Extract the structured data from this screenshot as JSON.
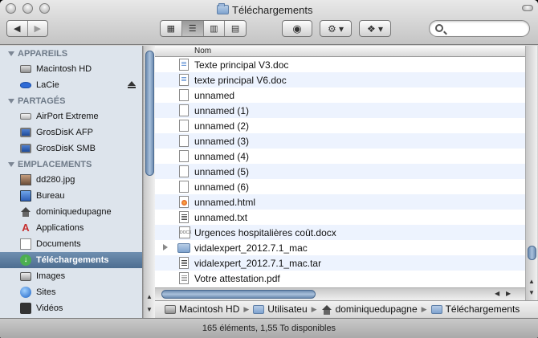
{
  "window": {
    "title": "Téléchargements",
    "toolbar": {
      "back_icon": "back-arrow-icon",
      "forward_icon": "forward-arrow-icon",
      "views": [
        "icon-view",
        "list-view",
        "column-view",
        "coverflow-view"
      ],
      "active_view": "list-view",
      "quicklook_icon": "eye-icon",
      "action_icon": "gear-icon",
      "dropbox_icon": "dropbox-icon",
      "search_placeholder": ""
    }
  },
  "sidebar": {
    "sections": [
      {
        "label": "APPAREILS",
        "items": [
          {
            "label": "Macintosh HD",
            "icon": "hard-drive-icon"
          },
          {
            "label": "LaCie",
            "icon": "external-drive-icon",
            "eject": true
          }
        ]
      },
      {
        "label": "PARTAGÉS",
        "items": [
          {
            "label": "AirPort Extreme",
            "icon": "airport-icon"
          },
          {
            "label": "GrosDisK AFP",
            "icon": "network-screen-icon"
          },
          {
            "label": "GrosDisK SMB",
            "icon": "network-screen-icon"
          }
        ]
      },
      {
        "label": "EMPLACEMENTS",
        "items": [
          {
            "label": "dd280.jpg",
            "icon": "photo-icon"
          },
          {
            "label": "Bureau",
            "icon": "desktop-icon"
          },
          {
            "label": "dominiquedupagne",
            "icon": "home-icon"
          },
          {
            "label": "Applications",
            "icon": "applications-icon"
          },
          {
            "label": "Documents",
            "icon": "documents-icon"
          },
          {
            "label": "Téléchargements",
            "icon": "downloads-icon",
            "selected": true
          },
          {
            "label": "Images",
            "icon": "camera-icon"
          },
          {
            "label": "Sites",
            "icon": "globe-icon"
          },
          {
            "label": "Vidéos",
            "icon": "video-icon"
          }
        ]
      }
    ]
  },
  "list": {
    "column_header": "Nom",
    "rows": [
      {
        "name": "Texte principal V3.doc",
        "type": "doc"
      },
      {
        "name": "texte principal V6.doc",
        "type": "doc"
      },
      {
        "name": "unnamed",
        "type": "blank"
      },
      {
        "name": "unnamed (1)",
        "type": "blank"
      },
      {
        "name": "unnamed (2)",
        "type": "blank"
      },
      {
        "name": "unnamed (3)",
        "type": "blank"
      },
      {
        "name": "unnamed (4)",
        "type": "blank"
      },
      {
        "name": "unnamed (5)",
        "type": "blank"
      },
      {
        "name": "unnamed (6)",
        "type": "blank"
      },
      {
        "name": "unnamed.html",
        "type": "html"
      },
      {
        "name": "unnamed.txt",
        "type": "txt"
      },
      {
        "name": "Urgences hospitalières coût.docx",
        "type": "docx"
      },
      {
        "name": "vidalexpert_2012.7.1_mac",
        "type": "folder"
      },
      {
        "name": "vidalexpert_2012.7.1_mac.tar",
        "type": "txt"
      },
      {
        "name": "Votre attestation.pdf",
        "type": "pdf"
      }
    ]
  },
  "pathbar": {
    "crumbs": [
      {
        "label": "Macintosh HD",
        "icon": "hard-drive-icon"
      },
      {
        "label": "Utilisateu",
        "icon": "folder-icon"
      },
      {
        "label": "dominiquedupagne",
        "icon": "home-icon"
      },
      {
        "label": "Téléchargements",
        "icon": "folder-icon"
      }
    ]
  },
  "status": {
    "text": "165 éléments, 1,55 To disponibles"
  }
}
